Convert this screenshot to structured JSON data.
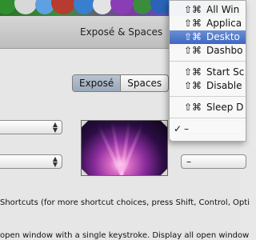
{
  "window": {
    "title": "Exposé & Spaces"
  },
  "tabs": [
    {
      "label": "Exposé",
      "active": true
    },
    {
      "label": "Spaces",
      "active": false
    }
  ],
  "corner_popups": {
    "right_value": "–"
  },
  "text": {
    "shortcuts": "Shortcuts (for more shortcut choices, press Shift, Control, Opti",
    "description": "open window with a single keystroke. Display all open window"
  },
  "menu": {
    "items": [
      {
        "keys": "⇧⌘",
        "label": "All Win",
        "highlighted": false
      },
      {
        "keys": "⇧⌘",
        "label": "Applica",
        "highlighted": false
      },
      {
        "keys": "⇧⌘",
        "label": "Deskto",
        "highlighted": true
      },
      {
        "keys": "⇧⌘",
        "label": "Dashbo",
        "highlighted": false
      },
      {
        "keys": "⇧⌘",
        "label": "Start Sc",
        "highlighted": false
      },
      {
        "keys": "⇧⌘",
        "label": "Disable",
        "highlighted": false
      },
      {
        "keys": "⇧⌘",
        "label": "Sleep D",
        "highlighted": false
      }
    ],
    "selected_item": {
      "check": "✓",
      "label": "–"
    }
  },
  "colors": {
    "highlight": "#3d67c2",
    "tab_active": "#9aa8ba"
  }
}
